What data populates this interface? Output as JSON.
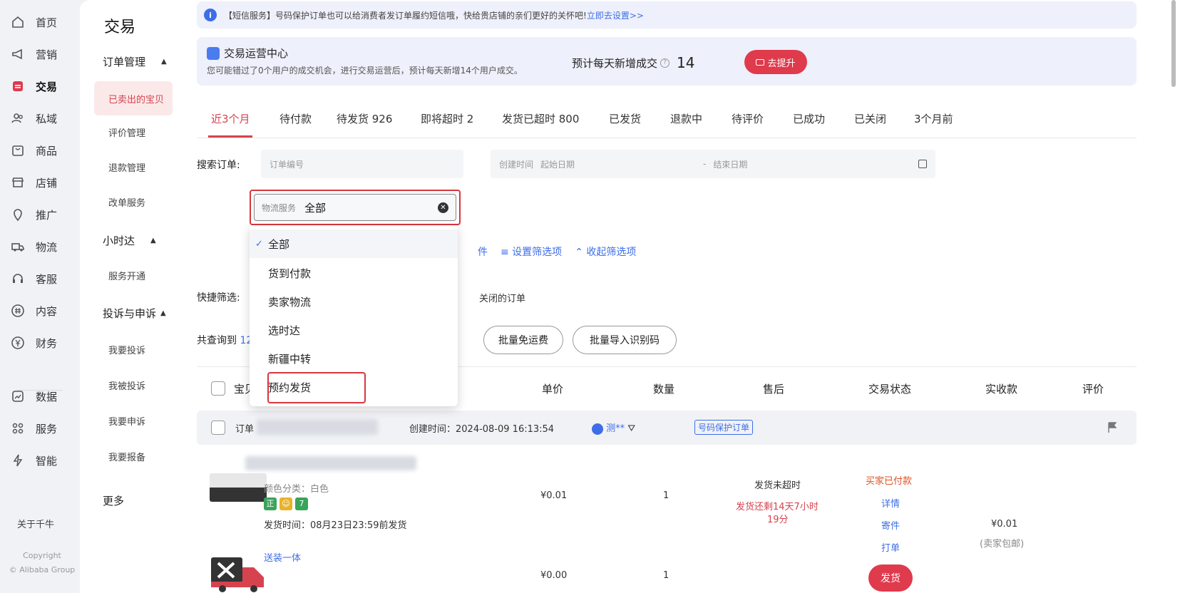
{
  "nav": {
    "items": [
      {
        "label": "首页",
        "icon": "home-icon"
      },
      {
        "label": "营销",
        "icon": "megaphone-icon"
      },
      {
        "label": "交易",
        "icon": "trade-icon"
      },
      {
        "label": "私域",
        "icon": "users-icon"
      },
      {
        "label": "商品",
        "icon": "goods-icon"
      },
      {
        "label": "店铺",
        "icon": "shop-icon"
      },
      {
        "label": "推广",
        "icon": "location-icon"
      },
      {
        "label": "物流",
        "icon": "truck-icon"
      },
      {
        "label": "客服",
        "icon": "headset-icon"
      },
      {
        "label": "内容",
        "icon": "hash-icon"
      },
      {
        "label": "财务",
        "icon": "yen-icon"
      },
      {
        "label": "数据",
        "icon": "chart-icon"
      },
      {
        "label": "服务",
        "icon": "grid-icon"
      },
      {
        "label": "智能",
        "icon": "bolt-icon"
      }
    ],
    "about": "关于千牛",
    "copyright_line1": "Copyright",
    "copyright_line2": "© Alibaba Group"
  },
  "submenu": {
    "title": "交易",
    "group1": "订单管理",
    "group1_items": [
      "已卖出的宝贝",
      "评价管理",
      "退款管理",
      "改单服务"
    ],
    "group2": "小时达",
    "group2_items": [
      "服务开通"
    ],
    "group3": "投诉与申诉",
    "group3_items": [
      "我要投诉",
      "我被投诉",
      "我要申诉",
      "我要报备"
    ],
    "more": "更多"
  },
  "notice": {
    "text": "【短信服务】号码保护订单也可以给消费者发订单履约短信哦，快给贵店铺的亲们更好的关怀吧!",
    "link": "立即去设置>>"
  },
  "opcenter": {
    "title": "交易运营中心",
    "subtitle": "您可能错过了0个用户的成交机会，进行交易运营后，预计每天新增14个用户成交。",
    "predict_label": "预计每天新增成交",
    "predict_value": "14",
    "button": "去提升"
  },
  "tabs": [
    "近3个月",
    "待付款",
    "待发货 926",
    "即将超时 2",
    "发货已超时 800",
    "已发货",
    "退款中",
    "待评价",
    "已成功",
    "已关闭",
    "3个月前"
  ],
  "search": {
    "label": "搜索订单:",
    "order_placeholder": "订单编号",
    "date_label": "创建时间",
    "start_placeholder": "起始日期",
    "dash": "-",
    "end_placeholder": "结束日期",
    "logistics_label": "物流服务",
    "logistics_value": "全部"
  },
  "filters": {
    "partial": "件",
    "set_filter": "≡ 设置筛选项",
    "collapse": "⌃ 收起筛选项",
    "quick_label": "快捷筛选:",
    "quick_tail": "关闭的订单"
  },
  "dropdown": {
    "options": [
      "全部",
      "货到付款",
      "卖家物流",
      "选时达",
      "新疆中转",
      "预约发货"
    ],
    "selected": "全部"
  },
  "toolbar": {
    "total_prefix": "共查询到",
    "total_num": "124",
    "btn_free_shipping": "批量免运费",
    "btn_import_code": "批量导入识别码"
  },
  "table": {
    "headers": [
      "宝贝",
      "单价",
      "数量",
      "售后",
      "交易状态",
      "实收款",
      "评价"
    ]
  },
  "order": {
    "order_prefix": "订单",
    "created": "创建时间：2024-08-09 16:13:54",
    "buyer": "测**",
    "protect_badge": "号码保护订单",
    "item1": {
      "sku": "颜色分类：白色",
      "tags": [
        "正",
        "",
        "7"
      ],
      "ship_time": "发货时间：08月23日23:59前发货",
      "price": "¥0.01",
      "qty": "1",
      "aftersale_title": "发货未超时",
      "aftersale_line1": "发货还剩14天7小时",
      "aftersale_line2": "19分",
      "status": "买家已付款",
      "detail": "详情",
      "send": "寄件",
      "print": "打单",
      "paid": "¥0.01",
      "paid_note": "(卖家包邮)"
    },
    "item2": {
      "name": "送装一体",
      "price": "¥0.00",
      "qty": "1",
      "ship_button": "发货"
    }
  }
}
